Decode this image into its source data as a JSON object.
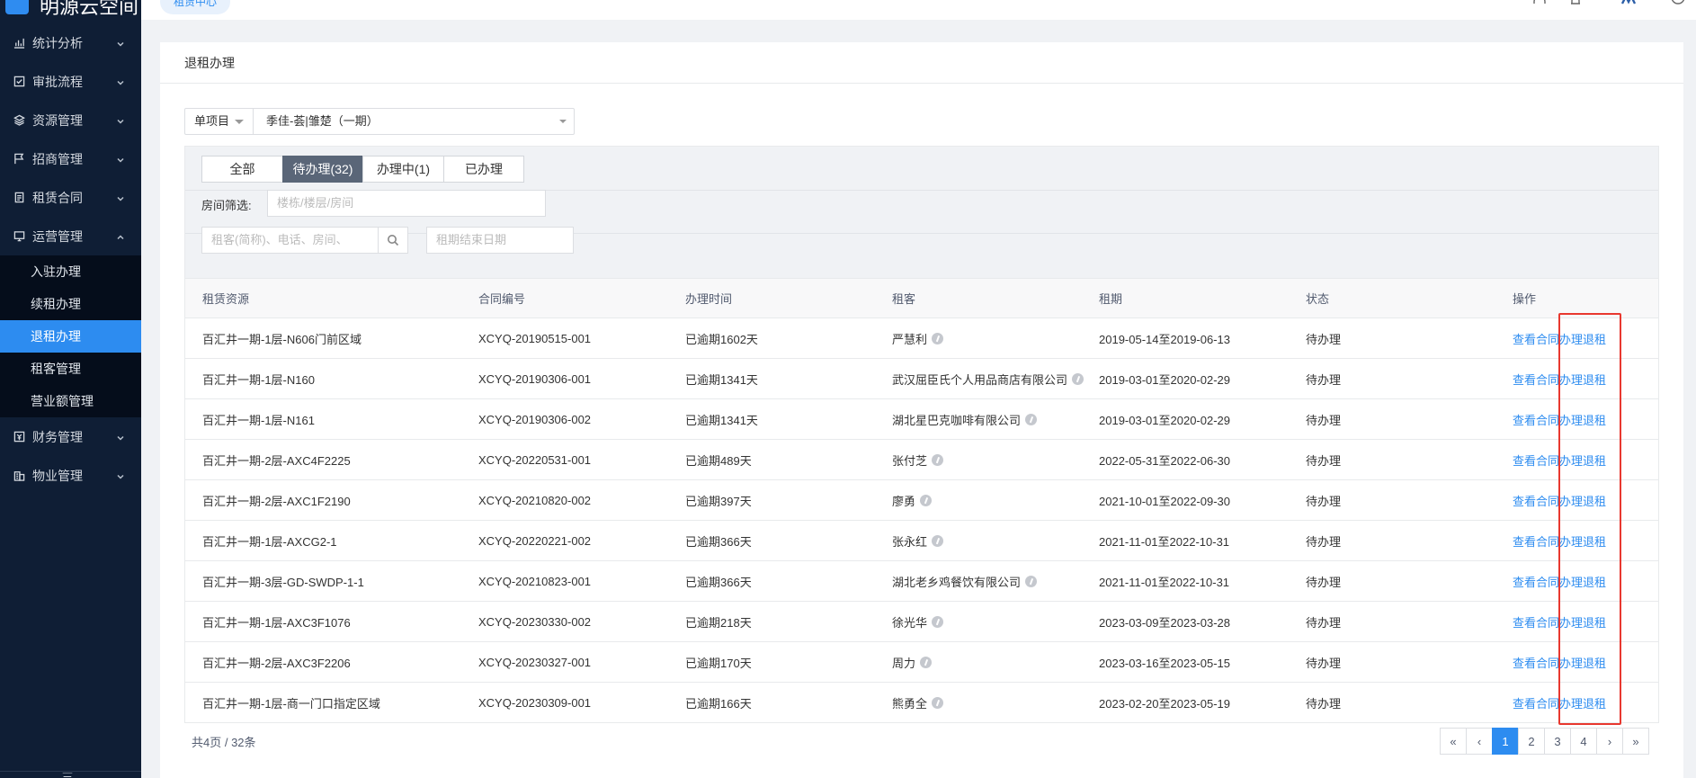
{
  "sidebar": {
    "logo_text": "明源云空间",
    "menu": [
      {
        "label": "统计分析",
        "icon": "chart-icon"
      },
      {
        "label": "审批流程",
        "icon": "checkbox-icon"
      },
      {
        "label": "资源管理",
        "icon": "layers-icon"
      },
      {
        "label": "招商管理",
        "icon": "flag-icon"
      },
      {
        "label": "租赁合同",
        "icon": "document-icon"
      },
      {
        "label": "运营管理",
        "icon": "monitor-icon",
        "expanded": true
      }
    ],
    "submenu": [
      {
        "label": "入驻办理"
      },
      {
        "label": "续租办理"
      },
      {
        "label": "退租办理",
        "active": true
      },
      {
        "label": "租客管理"
      },
      {
        "label": "营业额管理"
      }
    ],
    "menu_after": [
      {
        "label": "财务管理",
        "icon": "finance-icon"
      },
      {
        "label": "物业管理",
        "icon": "building-icon"
      }
    ],
    "collapse_glyph": "三"
  },
  "topbar": {
    "tag": "租赁中心"
  },
  "page": {
    "title": "退租办理",
    "project_scope": "单项目",
    "project_value": "季佳-荟|雏楚（一期）",
    "tabs": [
      {
        "label": "全部"
      },
      {
        "label": "待办理(32)",
        "active": true
      },
      {
        "label": "办理中(1)"
      },
      {
        "label": "已办理"
      }
    ],
    "room_filter_label": "房间筛选:",
    "room_filter_placeholder": "楼栋/楼层/房间",
    "search_placeholder": "租客(简称)、电话、房间、",
    "date_placeholder": "租期结束日期"
  },
  "table": {
    "columns": [
      "租赁资源",
      "合同编号",
      "办理时间",
      "租客",
      "租期",
      "状态",
      "操作"
    ],
    "rows": [
      {
        "resource": "百汇井一期-1层-N606门前区域",
        "contract": "XCYQ-20190515-001",
        "time": "已逾期1602天",
        "tenant": "严慧利",
        "term": "2019-05-14至2019-06-13",
        "status": "待办理",
        "action_view": "查看合同",
        "action_handle": "办理退租"
      },
      {
        "resource": "百汇井一期-1层-N160",
        "contract": "XCYQ-20190306-001",
        "time": "已逾期1341天",
        "tenant": "武汉屈臣氏个人用品商店有限公司",
        "term": "2019-03-01至2020-02-29",
        "status": "待办理",
        "action_view": "查看合同",
        "action_handle": "办理退租"
      },
      {
        "resource": "百汇井一期-1层-N161",
        "contract": "XCYQ-20190306-002",
        "time": "已逾期1341天",
        "tenant": "湖北星巴克咖啡有限公司",
        "term": "2019-03-01至2020-02-29",
        "status": "待办理",
        "action_view": "查看合同",
        "action_handle": "办理退租"
      },
      {
        "resource": "百汇井一期-2层-AXC4F2225",
        "contract": "XCYQ-20220531-001",
        "time": "已逾期489天",
        "tenant": "张付芝",
        "term": "2022-05-31至2022-06-30",
        "status": "待办理",
        "action_view": "查看合同",
        "action_handle": "办理退租"
      },
      {
        "resource": "百汇井一期-2层-AXC1F2190",
        "contract": "XCYQ-20210820-002",
        "time": "已逾期397天",
        "tenant": "廖勇",
        "term": "2021-10-01至2022-09-30",
        "status": "待办理",
        "action_view": "查看合同",
        "action_handle": "办理退租"
      },
      {
        "resource": "百汇井一期-1层-AXCG2-1",
        "contract": "XCYQ-20220221-002",
        "time": "已逾期366天",
        "tenant": "张永红",
        "term": "2021-11-01至2022-10-31",
        "status": "待办理",
        "action_view": "查看合同",
        "action_handle": "办理退租"
      },
      {
        "resource": "百汇井一期-3层-GD-SWDP-1-1",
        "contract": "XCYQ-20210823-001",
        "time": "已逾期366天",
        "tenant": "湖北老乡鸡餐饮有限公司",
        "term": "2021-11-01至2022-10-31",
        "status": "待办理",
        "action_view": "查看合同",
        "action_handle": "办理退租"
      },
      {
        "resource": "百汇井一期-1层-AXC3F1076",
        "contract": "XCYQ-20230330-002",
        "time": "已逾期218天",
        "tenant": "徐光华",
        "term": "2023-03-09至2023-03-28",
        "status": "待办理",
        "action_view": "查看合同",
        "action_handle": "办理退租"
      },
      {
        "resource": "百汇井一期-2层-AXC3F2206",
        "contract": "XCYQ-20230327-001",
        "time": "已逾期170天",
        "tenant": "周力",
        "term": "2023-03-16至2023-05-15",
        "status": "待办理",
        "action_view": "查看合同",
        "action_handle": "办理退租"
      },
      {
        "resource": "百汇井一期-1层-商一门口指定区域",
        "contract": "XCYQ-20230309-001",
        "time": "已逾期166天",
        "tenant": "熊勇全",
        "term": "2023-02-20至2023-05-19",
        "status": "待办理",
        "action_view": "查看合同",
        "action_handle": "办理退租"
      }
    ]
  },
  "pagination": {
    "total_text": "共4页 / 32条",
    "first": "«",
    "prev": "‹",
    "pages": [
      "1",
      "2",
      "3",
      "4"
    ],
    "current": "1",
    "next": "›",
    "last": "»"
  },
  "colors": {
    "sidebar_bg": "#0f1e35",
    "accent": "#2d8cf0",
    "highlight_box": "#e8382f"
  }
}
